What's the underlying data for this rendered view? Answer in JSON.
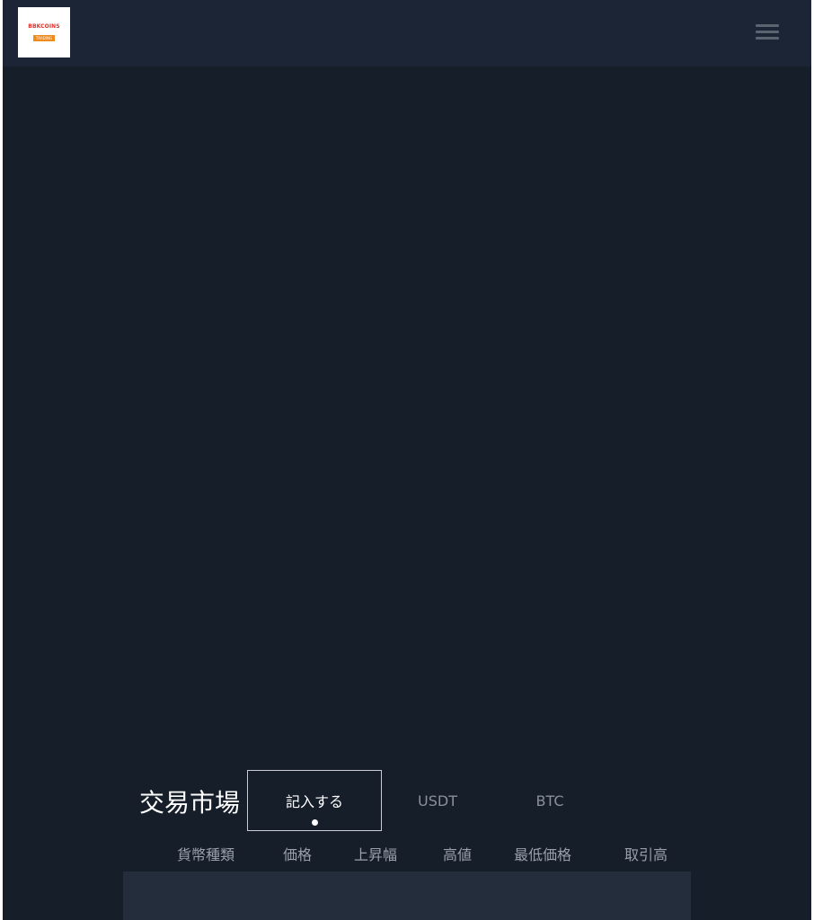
{
  "header": {
    "logo": {
      "title": "BBKCOINS",
      "subtitle": "TRADING"
    },
    "menu_icon": "hamburger-menu-icon"
  },
  "market": {
    "title": "交易市場",
    "tabs": [
      {
        "label": "記入する",
        "active": true
      },
      {
        "label": "USDT",
        "active": false
      },
      {
        "label": "BTC",
        "active": false
      }
    ],
    "columns": [
      "貨幣種類",
      "価格",
      "上昇幅",
      "高値",
      "最低価格",
      "取引高"
    ]
  },
  "colors": {
    "page_background": "#161e2a",
    "header_background": "#1b2536",
    "table_background": "#242d3b",
    "brand_red": "#e0302a",
    "brand_orange": "#f08a1c"
  }
}
